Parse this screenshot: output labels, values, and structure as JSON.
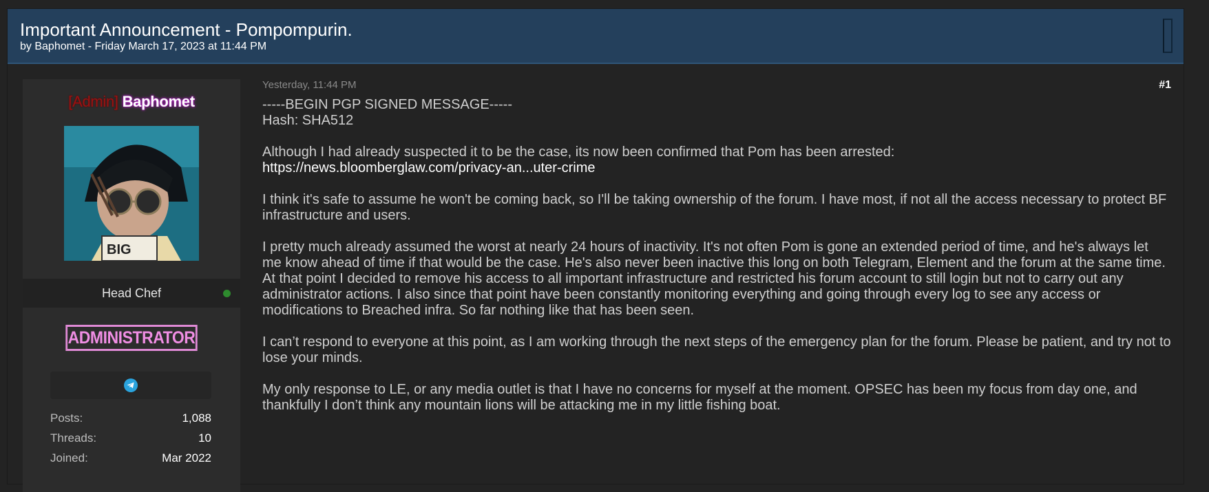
{
  "thread": {
    "title": "Important Announcement - Pompompurin.",
    "meta": "by Baphomet - Friday March 17, 2023 at 11:44 PM"
  },
  "author": {
    "role_tag": "[Admin]",
    "username": "Baphomet",
    "user_title": "Head Chef",
    "badge": "ADMINISTRATOR",
    "online_color": "#2e8b2e",
    "contact_icon": "telegram-icon",
    "stats": [
      {
        "label": "Posts:",
        "value": "1,088"
      },
      {
        "label": "Threads:",
        "value": "10"
      },
      {
        "label": "Joined:",
        "value": "Mar 2022"
      }
    ]
  },
  "post": {
    "date": "Yesterday, 11:44 PM",
    "number": "#1",
    "pgp_header": "-----BEGIN PGP SIGNED MESSAGE-----",
    "hash": "Hash: SHA512",
    "p1": "Although I had already suspected it to be the case, its now been confirmed that Pom has been arrested:",
    "link": "https://news.bloomberglaw.com/privacy-an...uter-crime",
    "p2": "I think it's safe to assume he won't be coming back, so I'll be taking ownership of the forum. I have most, if not all the access necessary to protect BF infrastructure and users.",
    "p3": "I pretty much already assumed the worst at nearly 24 hours of inactivity. It's not often Pom is gone an extended period of time, and he's always let me know ahead of time if that would be the case. He's also never been inactive this long on both Telegram, Element and the forum at the same time. At that point I decided to remove his access to all important infrastructure and restricted his forum account to still login but not to carry out any administrator actions. I also since that point have been constantly monitoring everything and going through every log to see any access or modifications to Breached infra. So far nothing like that has been seen.",
    "p4": "I can’t respond to everyone at this point, as I am working through the next steps of the emergency plan for the forum. Please be patient, and try not to lose your minds.",
    "p5": "My only response to LE, or any media outlet is that I have no concerns for myself at the moment. OPSEC has been my focus from day one, and thankfully I don’t think any mountain lions will be attacking me in my little fishing boat."
  },
  "colors": {
    "header_bg": "#24405c",
    "role_tag": "#9b1212",
    "badge": "#f08ee4"
  }
}
